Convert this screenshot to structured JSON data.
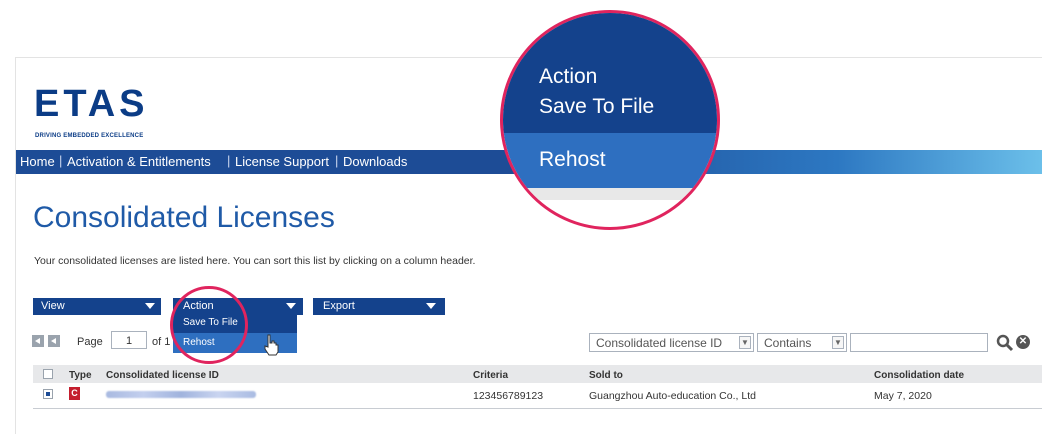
{
  "logo": {
    "name": "ETAS",
    "tagline": "DRIVING EMBEDDED EXCELLENCE"
  },
  "nav": {
    "items": [
      "Home",
      "Activation & Entitlements",
      "License Support",
      "Downloads"
    ],
    "separator": "|"
  },
  "page": {
    "title": "Consolidated Licenses",
    "description": "Your consolidated licenses are listed here. You can sort this list by clicking on a column header."
  },
  "toolbar": {
    "view_label": "View",
    "action_label": "Action",
    "export_label": "Export",
    "action_menu": [
      "Save To File",
      "Rehost"
    ]
  },
  "pagination": {
    "page_label": "Page",
    "current_page": "1",
    "of_label": "of 1"
  },
  "filters": {
    "field": "Consolidated license ID",
    "operator": "Contains",
    "search_value": "",
    "clear_symbol": "✕"
  },
  "table": {
    "columns": [
      "Type",
      "Consolidated license ID",
      "Criteria",
      "Sold to",
      "Consolidation date"
    ],
    "rows": [
      {
        "type": "C",
        "criteria": "123456789123",
        "sold_to": "Guangzhou Auto-education Co., Ltd",
        "date": "May 7, 2020"
      }
    ]
  },
  "zoom_callout": {
    "action_label": "Action",
    "save_label": "Save To File",
    "rehost_label": "Rehost"
  },
  "colors": {
    "primary": "#14428c",
    "highlight": "#2e6fc0",
    "callout": "#e0245e",
    "title": "#1f5aa7"
  },
  "icons": [
    "search-icon",
    "clear-icon",
    "first-page-icon",
    "prev-page-icon",
    "pointer-cursor-icon",
    "chevron-down-icon"
  ]
}
